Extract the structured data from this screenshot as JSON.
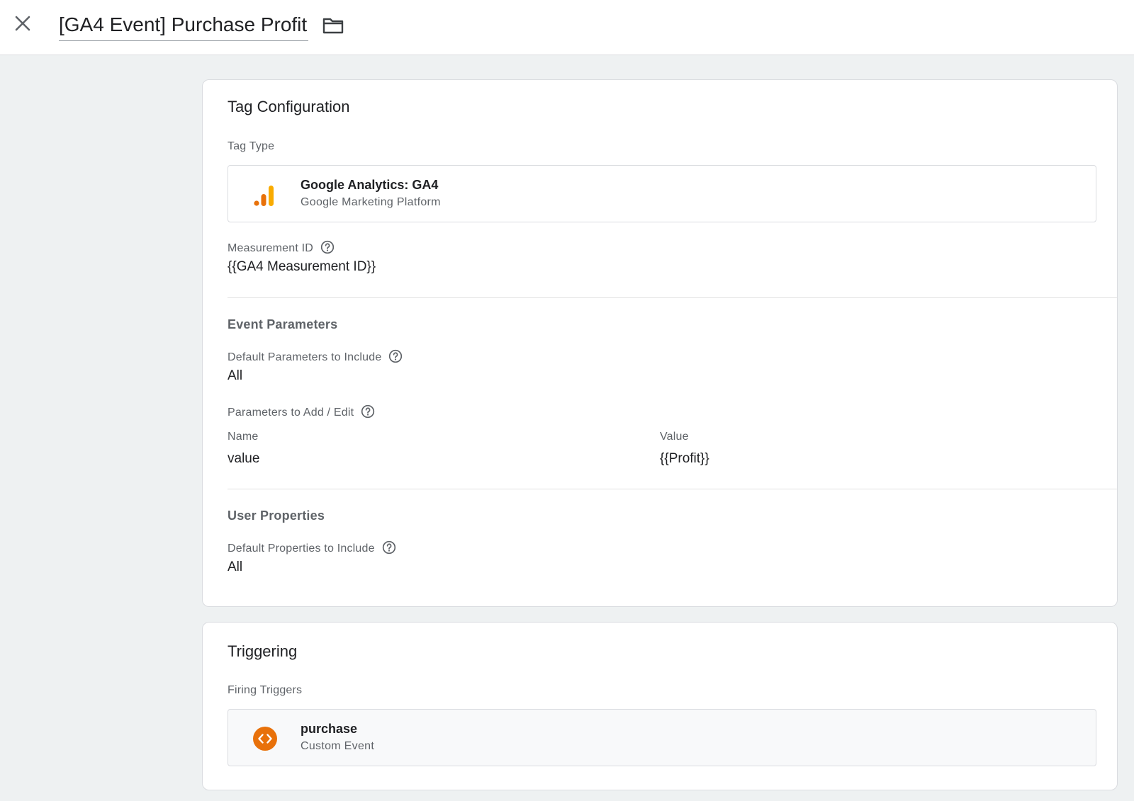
{
  "header": {
    "title": "[GA4 Event] Purchase Profit",
    "close_icon": "close-icon",
    "folder_icon": "folder-icon"
  },
  "tag_configuration": {
    "title": "Tag Configuration",
    "tag_type_label": "Tag Type",
    "tag_type": {
      "name": "Google Analytics: GA4",
      "vendor": "Google Marketing Platform",
      "icon": "google-analytics-bars-icon"
    },
    "measurement_id_label": "Measurement ID",
    "measurement_id_value": "{{GA4 Measurement ID}}",
    "event_parameters": {
      "heading": "Event Parameters",
      "default_label": "Default Parameters to Include",
      "default_value": "All",
      "add_edit_label": "Parameters to Add / Edit",
      "columns": [
        "Name",
        "Value"
      ],
      "rows": [
        {
          "name": "value",
          "value": "{{Profit}}"
        }
      ]
    },
    "user_properties": {
      "heading": "User Properties",
      "default_label": "Default Properties to Include",
      "default_value": "All"
    }
  },
  "triggering": {
    "title": "Triggering",
    "firing_label": "Firing Triggers",
    "trigger": {
      "name": "purchase",
      "type": "Custom Event",
      "icon": "custom-event-code-icon"
    }
  },
  "colors": {
    "accent_orange": "#e8710a",
    "ga_bar_light": "#f9ab00",
    "background": "#eef1f2",
    "text_primary": "#202124",
    "text_secondary": "#5f6368"
  }
}
